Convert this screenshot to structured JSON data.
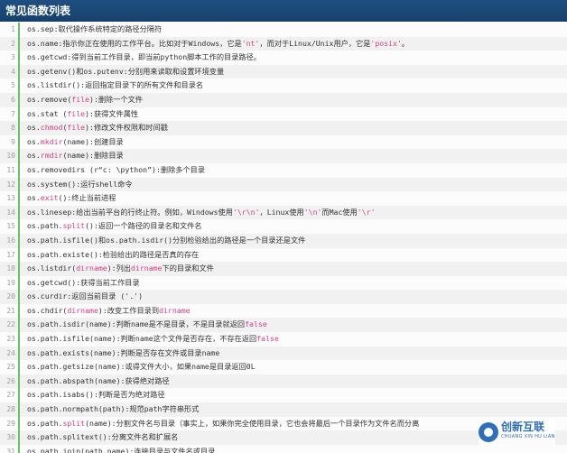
{
  "title": "常见函数列表",
  "colors": {
    "title_bg": "#1f4f80",
    "accent_text": "#d23f87",
    "gutter": "#6ac16a"
  },
  "lines": [
    [
      {
        "t": "os.sep:取代操作系统特定的路径分隔符"
      }
    ],
    [
      {
        "t": "os.name:指示你正在使用的工作平台。比如对于Windows，它是"
      },
      {
        "t": "'nt'",
        "a": true
      },
      {
        "t": "，而对于Linux/Unix用户，它是"
      },
      {
        "t": "'posix'",
        "a": true
      },
      {
        "t": "。"
      }
    ],
    [
      {
        "t": "os.getcwd:得到当前工作目录，即当前python脚本工作的目录路径。"
      }
    ],
    [
      {
        "t": "os.getenv()和os.putenv:分别用来读取和设置环境变量"
      }
    ],
    [
      {
        "t": "os.listdir():返回指定目录下的所有文件和目录名"
      }
    ],
    [
      {
        "t": "os.remove("
      },
      {
        "t": "file",
        "a": true
      },
      {
        "t": "):删除一个文件"
      }
    ],
    [
      {
        "t": "os.stat ("
      },
      {
        "t": "file",
        "a": true
      },
      {
        "t": "):获得文件属性"
      }
    ],
    [
      {
        "t": "os."
      },
      {
        "t": "chmod",
        "a": true
      },
      {
        "t": "("
      },
      {
        "t": "file",
        "a": true
      },
      {
        "t": "):修改文件权限和时间戳"
      }
    ],
    [
      {
        "t": "os."
      },
      {
        "t": "mkdir",
        "a": true
      },
      {
        "t": "(name):创建目录"
      }
    ],
    [
      {
        "t": "os."
      },
      {
        "t": "rmdir",
        "a": true
      },
      {
        "t": "(name):删除目录"
      }
    ],
    [
      {
        "t": "os.removedirs (r“c: \\python”):删除多个目录"
      }
    ],
    [
      {
        "t": "os.system():运行shell命令"
      }
    ],
    [
      {
        "t": "os."
      },
      {
        "t": "exit",
        "a": true
      },
      {
        "t": "():终止当前进程"
      }
    ],
    [
      {
        "t": "os.linesep:给出当前平台的行终止符。例如，Windows使用"
      },
      {
        "t": "'\\r\\n'",
        "a": true
      },
      {
        "t": "，Linux使用"
      },
      {
        "t": "'\\n'",
        "a": true
      },
      {
        "t": "而Mac使用"
      },
      {
        "t": "'\\r'",
        "a": true
      }
    ],
    [
      {
        "t": "os.path."
      },
      {
        "t": "split",
        "a": true
      },
      {
        "t": "():返回一个路径的目录名和文件名"
      }
    ],
    [
      {
        "t": "os.path.isfile()和os.path.isdir()分别检验给出的路径是一个目录还是文件"
      }
    ],
    [
      {
        "t": "os.path.existe():检验给出的路径是否真的存在"
      }
    ],
    [
      {
        "t": "os.listdir("
      },
      {
        "t": "dirname",
        "a": true
      },
      {
        "t": "):列出"
      },
      {
        "t": "dirname",
        "a": true
      },
      {
        "t": "下的目录和文件"
      }
    ],
    [
      {
        "t": "os.getcwd():获得当前工作目录"
      }
    ],
    [
      {
        "t": "os.curdir:返回当前目录 ('.')"
      }
    ],
    [
      {
        "t": "os.chdir("
      },
      {
        "t": "dirname",
        "a": true
      },
      {
        "t": "):改变工作目录到"
      },
      {
        "t": "dirname",
        "a": true
      }
    ],
    [
      {
        "t": "os.path.isdir(name):判断name是不是目录，不是目录就返回"
      },
      {
        "t": "false",
        "a": true
      }
    ],
    [
      {
        "t": "os.path.isfile(name):判断name这个文件是否存在，不存在返回"
      },
      {
        "t": "false",
        "a": true
      }
    ],
    [
      {
        "t": "os.path.exists(name):判断是否存在文件或目录name"
      }
    ],
    [
      {
        "t": "os.path.getsize(name):或得文件大小，如果name是目录返回0L"
      }
    ],
    [
      {
        "t": "os.path.abspath(name):获得绝对路径"
      }
    ],
    [
      {
        "t": "os.path.isabs():判断是否为绝对路径"
      }
    ],
    [
      {
        "t": "os.path.normpath(path):规范path字符串形式"
      }
    ],
    [
      {
        "t": "os.path."
      },
      {
        "t": "split",
        "a": true
      },
      {
        "t": "(name):分割文件名与目录（事实上，如果你完全使用目录，它也会将最后一个目录作为文件名而分离"
      }
    ],
    [
      {
        "t": "os.path.splitext():分离文件名和扩展名"
      }
    ],
    [
      {
        "t": "os.path.join(path,name):连接目录与文件名或目录"
      }
    ]
  ],
  "watermark": {
    "name": "创新互联",
    "sub": "CHUANG XIN HU LIAN"
  }
}
